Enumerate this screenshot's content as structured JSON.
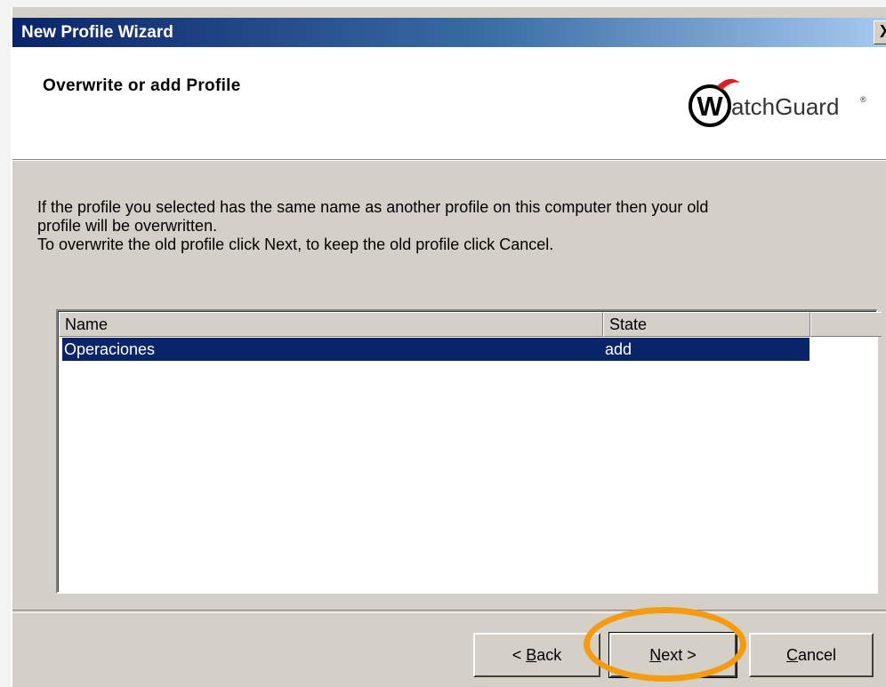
{
  "window": {
    "title": "New Profile Wizard",
    "close_label": "X"
  },
  "header": {
    "title": "Overwrite or add Profile",
    "logo_initial": "W",
    "logo_text": "atchGuard",
    "logo_trademark": "®"
  },
  "description": {
    "line1": "If the profile you selected has the same name as another profile on this computer then your old",
    "line2": "profile will be overwritten.",
    "line3": "To overwrite the old profile click Next, to keep the old profile click Cancel."
  },
  "table": {
    "columns": [
      "Name",
      "State"
    ],
    "rows": [
      {
        "name": "Operaciones",
        "state": "add",
        "selected": true
      }
    ]
  },
  "buttons": {
    "back_prefix": "< ",
    "back_mnemonic": "B",
    "back_rest": "ack",
    "next_mnemonic": "N",
    "next_rest": "ext >",
    "cancel_mnemonic": "C",
    "cancel_rest": "ancel"
  },
  "colors": {
    "selection": "#0a246a",
    "highlight_ring": "#f59b0f",
    "logo_red": "#e21b23"
  }
}
